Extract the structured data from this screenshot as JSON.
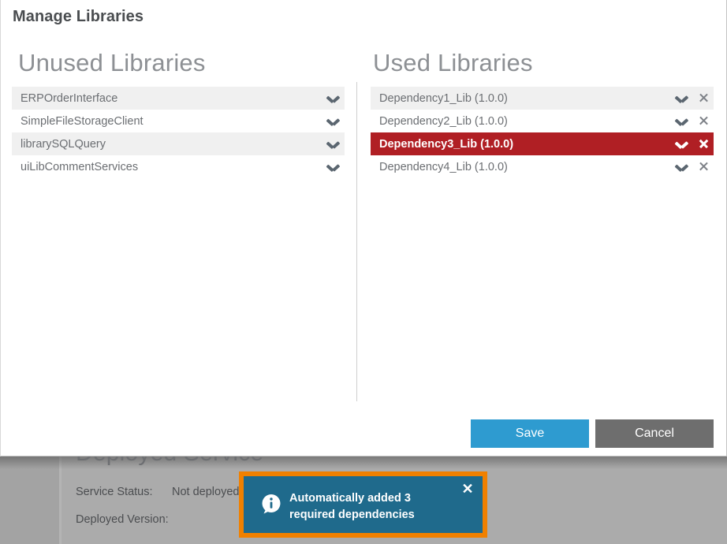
{
  "dialog": {
    "title": "Manage Libraries",
    "unused_panel": {
      "heading": "Unused Libraries",
      "rows": [
        {
          "label": "ERPOrderInterface"
        },
        {
          "label": "SimpleFileStorageClient"
        },
        {
          "label": "librarySQLQuery"
        },
        {
          "label": "uiLibCommentServices"
        }
      ]
    },
    "used_panel": {
      "heading": "Used Libraries",
      "rows": [
        {
          "label": "Dependency1_Lib (1.0.0)",
          "selected": false
        },
        {
          "label": "Dependency2_Lib (1.0.0)",
          "selected": false
        },
        {
          "label": "Dependency3_Lib (1.0.0)",
          "selected": true
        },
        {
          "label": "Dependency4_Lib (1.0.0)",
          "selected": false
        }
      ]
    },
    "footer": {
      "save_label": "Save",
      "cancel_label": "Cancel"
    }
  },
  "background_page": {
    "title": "Deployed Service",
    "service_status_label": "Service Status:",
    "service_status_value": "Not deployed",
    "deployed_version_label": "Deployed Version:"
  },
  "toast": {
    "message": "Automatically added 3 required dependencies",
    "close_label": "✕",
    "icon": "info-icon"
  },
  "colors": {
    "accent_blue": "#2e9bd0",
    "cancel_gray": "#6e6e6e",
    "selected_red": "#b01f24",
    "toast_border_orange": "#f08000",
    "toast_background": "#1f6a8c",
    "row_alt": "#f0f0f0"
  }
}
